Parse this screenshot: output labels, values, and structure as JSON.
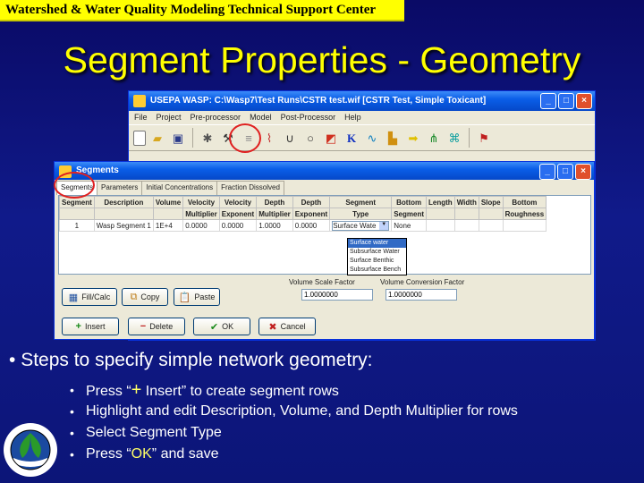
{
  "header": {
    "org_name": "Watershed & Water Quality Modeling Technical Support Center"
  },
  "slide": {
    "title": "Segment Properties - Geometry"
  },
  "app_window": {
    "title": "USEPA WASP: C:\\Wasp7\\Test Runs\\CSTR test.wif [CSTR Test, Simple Toxicant]",
    "menu": [
      "File",
      "Project",
      "Pre-processor",
      "Model",
      "Post-Processor",
      "Help"
    ],
    "toolbar_icons": [
      "new-document-icon",
      "open-folder-icon",
      "save-disk-icon",
      "settings-tool-icon",
      "segments-icon",
      "parameters-icon",
      "chart-icon",
      "curve-icon",
      "circle-icon",
      "run-icon",
      "k-icon",
      "wave-icon",
      "chart-bar-icon",
      "arrow-icon",
      "tree-icon",
      "network-icon",
      "flag-icon"
    ]
  },
  "segments_dialog": {
    "title": "Segments",
    "tabs": [
      "Segments",
      "Parameters",
      "Initial Concentrations",
      "Fraction Dissolved"
    ],
    "columns_row1": [
      "Segment",
      "Description",
      "Volume",
      "Velocity",
      "Velocity",
      "Depth",
      "Depth",
      "Segment",
      "Bottom",
      "Length",
      "Width",
      "Slope",
      "Bottom"
    ],
    "columns_row2": [
      "",
      "",
      "",
      "Multiplier",
      "Exponent",
      "Multiplier",
      "Exponent",
      "Type",
      "Segment",
      "",
      "",
      "",
      "Roughness"
    ],
    "row": {
      "segment": "1",
      "description": "Wasp Segment 1",
      "volume": "1E+4",
      "velocity_multiplier": "0.0000",
      "velocity_exponent": "0.0000",
      "depth_multiplier": "1.0000",
      "depth_exponent": "0.0000",
      "segment_type": "Surface Wate",
      "bottom_segment": "None"
    },
    "segment_type_options": [
      "Surface water",
      "Subsurface Water",
      "Surface Benthic",
      "Subsurface Bench"
    ],
    "selected_type_index": 0,
    "volume_scale_label": "Volume Scale Factor",
    "volume_scale_value": "1.0000000",
    "volume_conversion_label": "Volume Conversion Factor",
    "volume_conversion_value": "1.0000000",
    "buttons": {
      "fill_calc": "Fill/Calc",
      "copy": "Copy",
      "paste": "Paste",
      "insert": "Insert",
      "delete": "Delete",
      "ok": "OK",
      "cancel": "Cancel"
    }
  },
  "bullets": {
    "main": "Steps to specify simple network geometry:",
    "step1_pre": "Press  “",
    "step1_plus": "+",
    "step1_post": " Insert” to create segment rows",
    "step2": "Highlight and edit Description, Volume, and Depth Multiplier for rows",
    "step3": "Select Segment Type",
    "step4_pre": "Press “",
    "step4_ok": "OK",
    "step4_post": "” and save"
  },
  "colors": {
    "background": "#0c1578",
    "title": "#ffff00",
    "header_bar": "#ffff00",
    "highlight_circle": "#e02020"
  }
}
